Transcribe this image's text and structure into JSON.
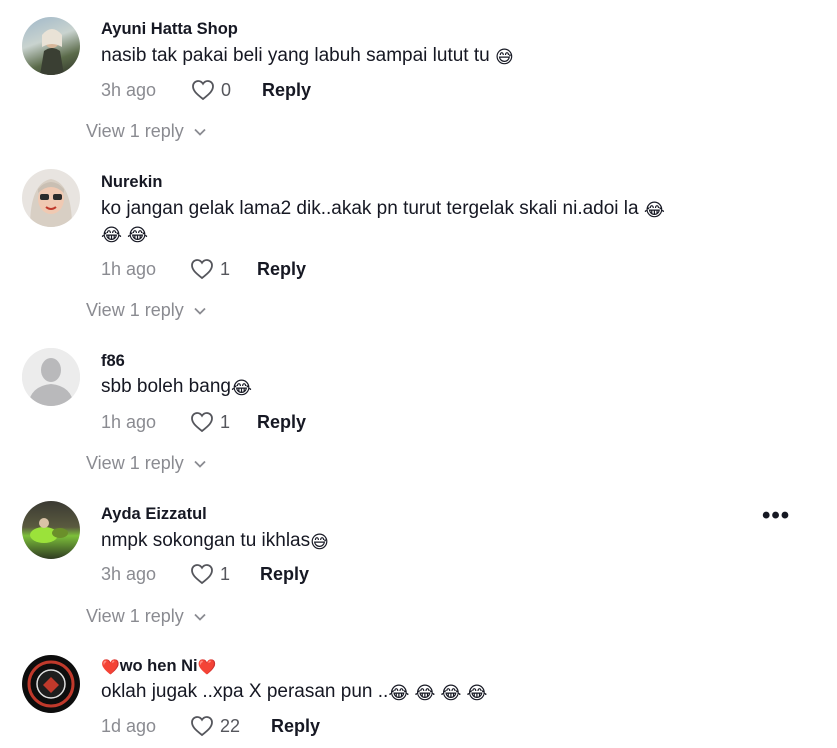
{
  "comments": [
    {
      "username": "Ayuni Hatta Shop",
      "text_line1": "nasib tak pakai beli yang labuh sampai lutut tu",
      "line1_emojis": "😅",
      "time": "3h ago",
      "likes": "0",
      "reply_label": "Reply",
      "view_label": "View 1 reply"
    },
    {
      "username": "Nurekin",
      "text_line1": "ko jangan gelak lama2 dik..akak pn turut tergelak skali ni.adoi la",
      "line1_emojis": "😂",
      "line2_emojis": "😂 😂",
      "time": "1h ago",
      "likes": "1",
      "reply_label": "Reply",
      "view_label": "View 1 reply"
    },
    {
      "username": "f86",
      "text_line1": "sbb boleh bang",
      "line1_emojis": "😂",
      "time": "1h ago",
      "likes": "1",
      "reply_label": "Reply",
      "view_label": "View 1 reply"
    },
    {
      "username": "Ayda Eizzatul",
      "text_line1": "nmpk sokongan tu ikhlas",
      "line1_emojis": "😅",
      "time": "3h ago",
      "likes": "1",
      "reply_label": "Reply",
      "view_label": "View 1 reply"
    },
    {
      "username": "wo hen Ni",
      "username_prefix": "❤️",
      "username_suffix": "❤️",
      "text_line1": "oklah jugak ..xpa X perasan pun ..",
      "line1_emojis": "😂 😂 😂 😂",
      "time": "1d ago",
      "likes": "22",
      "reply_label": "Reply"
    }
  ],
  "more_label": "•••",
  "icons": {
    "like": "heart-outline-icon",
    "expand": "chevron-down-icon",
    "more": "more-options-icon"
  },
  "colors": {
    "text": "#161823",
    "secondary": "#8a8b91",
    "heart_red": "#e0202d"
  }
}
